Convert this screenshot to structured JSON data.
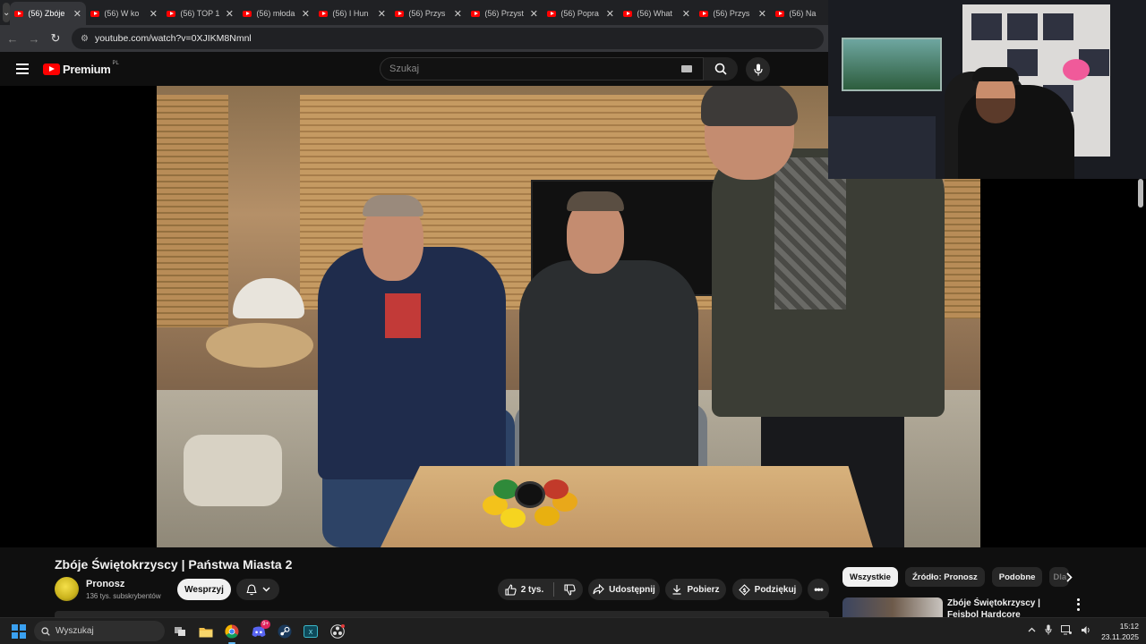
{
  "browser": {
    "tabs": [
      {
        "label": "(56) Zbóje",
        "active": true
      },
      {
        "label": "(56) W ko",
        "active": false
      },
      {
        "label": "(56) TOP 1",
        "active": false
      },
      {
        "label": "(56) młoda",
        "active": false
      },
      {
        "label": "(56) I Hun",
        "active": false
      },
      {
        "label": "(56) Przys",
        "active": false
      },
      {
        "label": "(56) Przyst",
        "active": false
      },
      {
        "label": "(56) Popra",
        "active": false
      },
      {
        "label": "(56) What",
        "active": false
      },
      {
        "label": "(56) Przys",
        "active": false
      },
      {
        "label": "(56) Na",
        "active": false
      }
    ],
    "url": "youtube.com/watch?v=0XJIKM8Nmnl"
  },
  "youtube": {
    "logo_text": "Premium",
    "logo_region": "PL",
    "search_placeholder": "Szukaj"
  },
  "video": {
    "title": "Zbóje Świętokrzyscy | Państwa Miasta 2",
    "channel": {
      "name": "Pronosz",
      "subscribers": "136 tys. subskrybentów",
      "support_label": "Wesprzyj"
    },
    "actions": {
      "likes": "2 tys.",
      "share": "Udostępnij",
      "download": "Pobierz",
      "thanks": "Podziękuj"
    }
  },
  "sidebar": {
    "chips": [
      "Wszystkie",
      "Źródło: Pronosz",
      "Podobne",
      "Dla"
    ],
    "recommendation": {
      "title": "Zbóje Świętokrzyscy | Fejsbol Hardcore"
    }
  },
  "taskbar": {
    "search_placeholder": "Wyszukaj",
    "discord_badge": "9+",
    "time": "15:12",
    "date": "23.11.2025"
  },
  "colors": {
    "youtube_red": "#ff0000",
    "background": "#0f0f0f",
    "accent": "#3aa0f0"
  }
}
